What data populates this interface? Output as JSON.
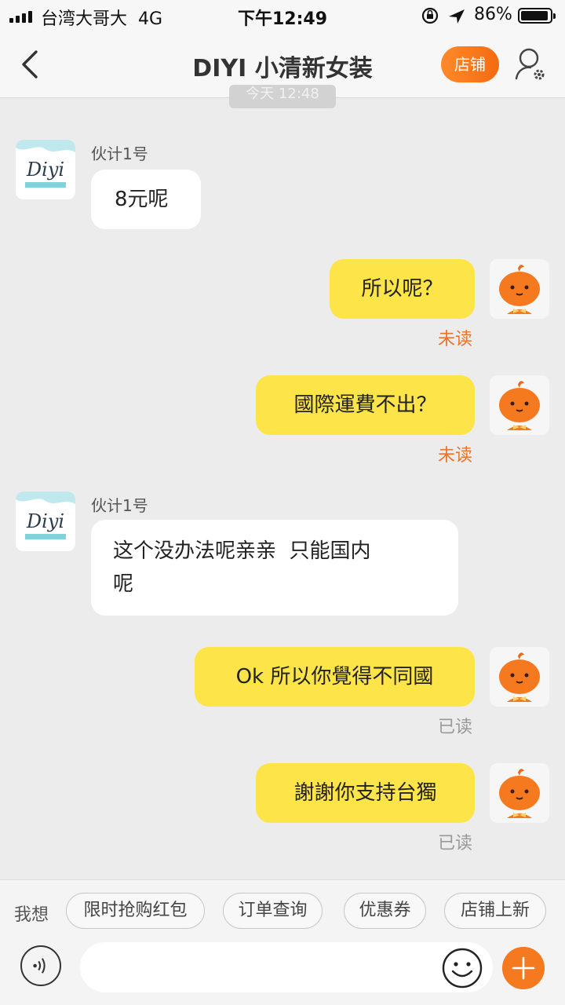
{
  "status": {
    "carrier": "台湾大哥大",
    "network": "4G",
    "time": "下午12:49",
    "battery": "86%"
  },
  "nav": {
    "title": "DIYI 小清新女装",
    "shop_label": "店铺"
  },
  "time_divider": "今天 12:48",
  "messages": [
    {
      "sender": "伙计1号",
      "text": "8元呢"
    },
    {
      "text": "所以呢？",
      "status": "未读"
    },
    {
      "text": "國際運費不出？",
      "status": "未读"
    },
    {
      "sender": "伙计1号",
      "line1": "这个没办法呢亲亲  只能国内",
      "line2": "呢"
    },
    {
      "text": "Ok 所以你覺得不同國",
      "status": "已读"
    },
    {
      "text": "謝謝你支持台獨",
      "status": "已读"
    }
  ],
  "quick": {
    "label": "我想",
    "chips": [
      "限时抢购红包",
      "订单查询",
      "优惠券",
      "店铺上新"
    ]
  },
  "shop_avatar_text": "Diyi",
  "colors": {
    "accent": "#f57a1f",
    "bubble_out": "#fde449",
    "unread": "#e8732d",
    "read": "#999999"
  },
  "icons": [
    "back-chevron-icon",
    "user-settings-icon",
    "voice-icon",
    "emoji-icon",
    "plus-icon",
    "signal-icon",
    "location-arrow-icon",
    "rotation-lock-icon",
    "battery-icon"
  ]
}
